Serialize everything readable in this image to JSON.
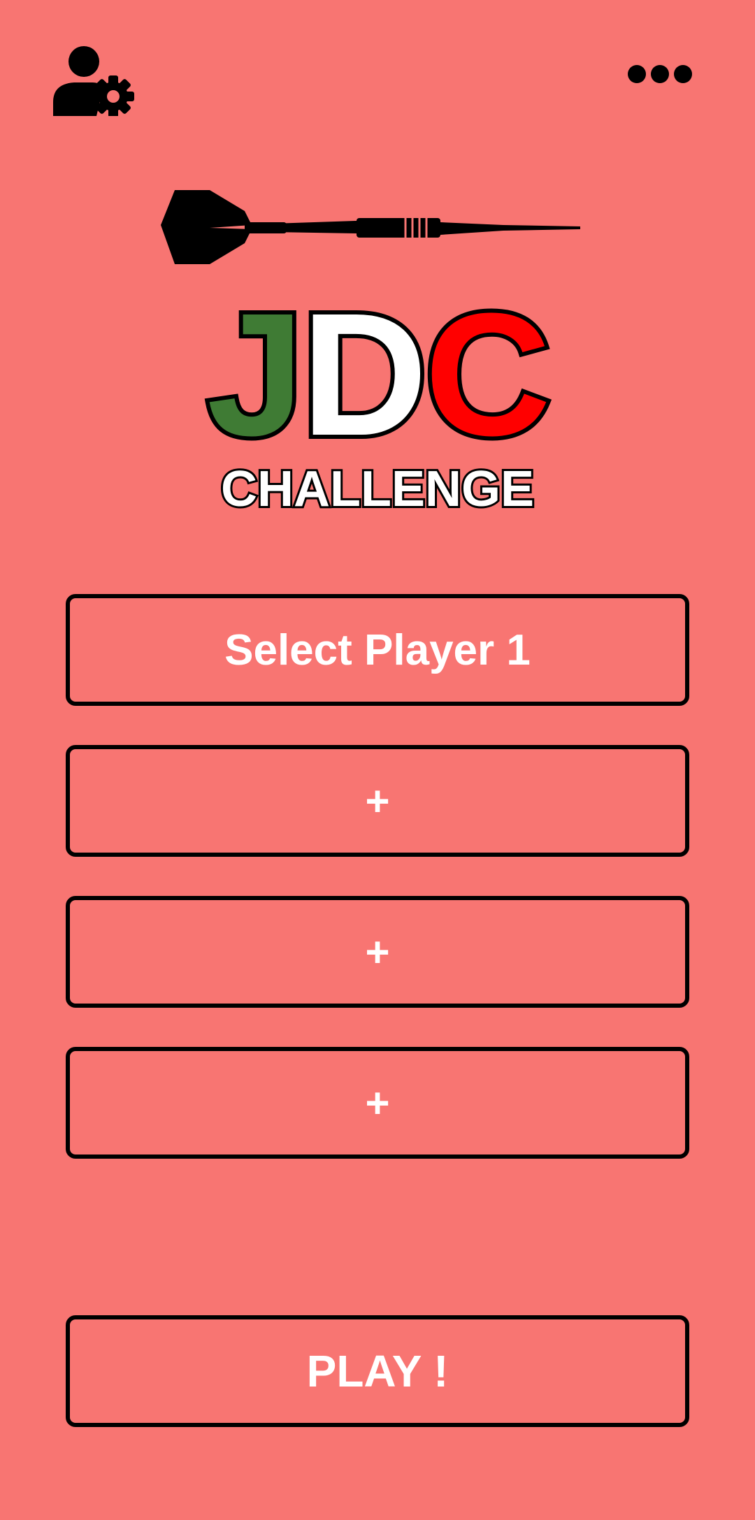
{
  "header": {
    "left_icon": "user-settings-icon",
    "right_icon": "more-horizontal-icon"
  },
  "logo": {
    "title": "JDC",
    "subtitle": "CHALLENGE",
    "colors": {
      "j": "#3f7b34",
      "d": "#ffffff",
      "c": "#ff0000",
      "outline": "#000000"
    }
  },
  "players": {
    "slots": [
      {
        "label": "Select Player 1"
      },
      {
        "label": "+"
      },
      {
        "label": "+"
      },
      {
        "label": "+"
      }
    ]
  },
  "actions": {
    "play_label": "PLAY !"
  },
  "colors": {
    "background": "#f87572",
    "border": "#000000",
    "text": "#ffffff"
  }
}
